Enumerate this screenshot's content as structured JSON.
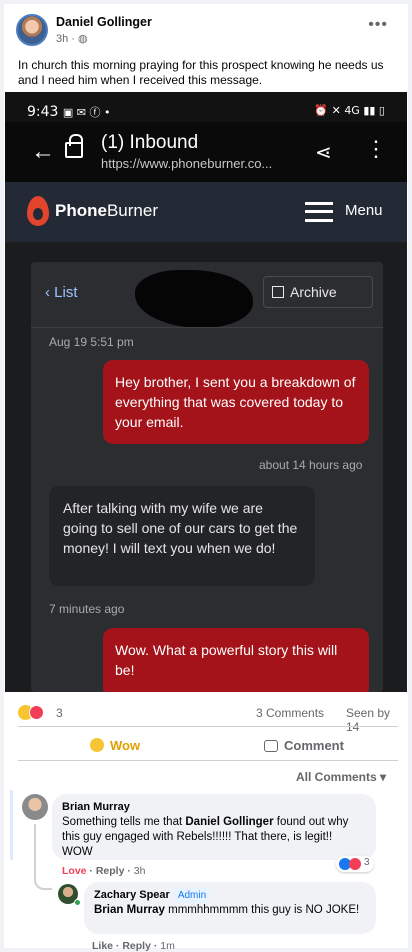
{
  "post": {
    "author": "Daniel Gollinger",
    "time": "3h · ",
    "globe_icon": "globe-icon",
    "more_icon": "more-dots-icon",
    "more_glyph": "•••",
    "text": "In church this morning praying for this prospect knowing he needs us and I need him when I received this message."
  },
  "screenshot": {
    "status_time": "9:43",
    "status_icons": "▣ ✉ ⓕ •",
    "status_right": "⏰ ✕ 4G ▮▮ ▯",
    "browser": {
      "title": "(1) Inbound",
      "url": "https://www.phoneburner.co...",
      "back_icon": "back-arrow-icon",
      "lock_icon": "lock-icon",
      "share_icon": "share-icon",
      "menu_icon": "kebab-menu-icon"
    },
    "app": {
      "logo_bold": "Phone",
      "logo_thin": "Burner",
      "menu_label": "Menu",
      "list_label": "‹ List",
      "archive_label": "Archive"
    },
    "messages": [
      {
        "direction": "outgoing",
        "timestamp": "Aug 19 5:51 pm",
        "text": "Hey brother, I sent you a breakdown of everything that was covered today to your email."
      },
      {
        "direction": "incoming",
        "timestamp": "about 14 hours ago",
        "text": "After talking with my wife we are going to sell one of our cars to get the money! I will text you when we do!"
      },
      {
        "direction": "outgoing",
        "timestamp": "7 minutes ago",
        "text": "Wow. What a powerful story this will be!"
      }
    ],
    "colors": {
      "outgoing_bubble": "#a4121a",
      "incoming_bubble": "#232427",
      "brand": "#e2452c"
    }
  },
  "reactions": {
    "count": "3",
    "comments": "3 Comments",
    "seen_by": "Seen by 14",
    "wow_label": "Wow",
    "comment_label": "Comment",
    "all_comments": "All Comments ▾"
  },
  "comments": [
    {
      "author": "Brian Murray",
      "pre": "Something tells me that ",
      "mention": "Daniel Gollinger",
      "post": " found out why this guy engaged with Rebels!!!!!! That there, is legit!! WOW",
      "love": "Love",
      "reply": " · Reply · ",
      "time": "3h",
      "reaction_count": "3"
    },
    {
      "author": "Zachary Spear",
      "badge": "Admin",
      "mention": "Brian Murray",
      "post": " mmmhhmmmm this guy is NO JOKE!",
      "like": "Like",
      "reply": " · Reply · ",
      "time": "1m"
    }
  ]
}
